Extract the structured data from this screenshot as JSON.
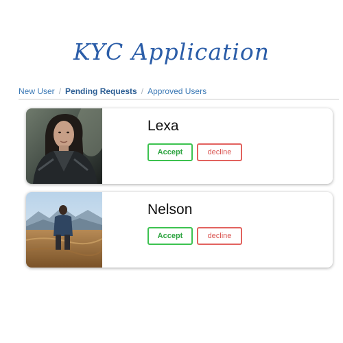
{
  "header": {
    "title": "KYC Application"
  },
  "breadcrumb": {
    "items": [
      {
        "label": "New User",
        "active": false
      },
      {
        "label": "Pending Requests",
        "active": true
      },
      {
        "label": "Approved Users",
        "active": false
      }
    ],
    "separator": "/"
  },
  "requests": [
    {
      "name": "Lexa",
      "accept_label": "Accept",
      "decline_label": "decline"
    },
    {
      "name": "Nelson",
      "accept_label": "Accept",
      "decline_label": "decline"
    }
  ],
  "colors": {
    "title": "#2b5da8",
    "link": "#3a78b5",
    "accept": "#3cc24f",
    "decline": "#e2625e"
  }
}
